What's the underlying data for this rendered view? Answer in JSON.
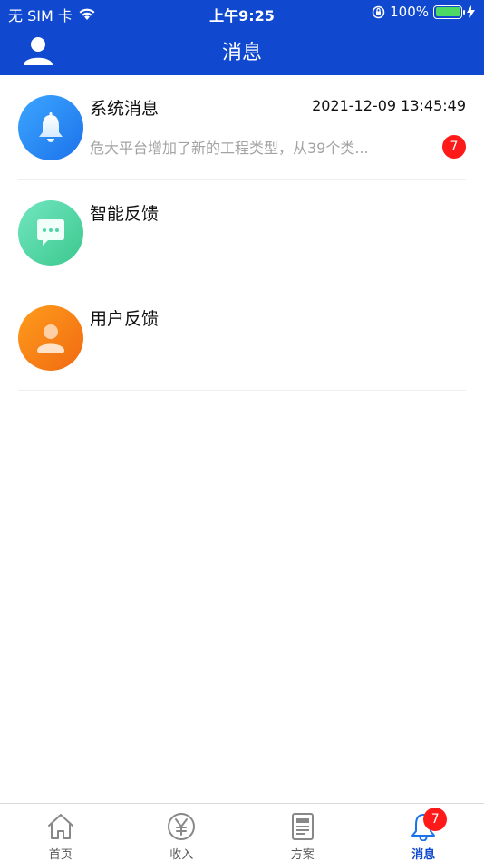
{
  "status_bar": {
    "carrier": "无 SIM 卡",
    "time": "上午9:25",
    "battery_percent": "100%",
    "battery_level": 1.0
  },
  "nav": {
    "title": "消息",
    "avatar_icon": "user-icon"
  },
  "messages": [
    {
      "title": "系统消息",
      "time": "2021-12-09 13:45:49",
      "preview": "危大平台增加了新的工程类型，从39个类...",
      "badge": "7",
      "icon": "bell-icon",
      "color": "#1c72ea"
    },
    {
      "title": "智能反馈",
      "icon": "chat-bubble-icon",
      "color": "#3cc88e"
    },
    {
      "title": "用户反馈",
      "icon": "user-icon",
      "color": "#f06a12"
    }
  ],
  "tabs": [
    {
      "label": "首页",
      "icon": "home-icon"
    },
    {
      "label": "收入",
      "icon": "yen-circle-icon"
    },
    {
      "label": "方案",
      "icon": "document-icon"
    },
    {
      "label": "消息",
      "icon": "bell-icon",
      "badge": "7",
      "active": true
    }
  ],
  "colors": {
    "brand": "#1049cf",
    "badge": "#ff1a1a"
  }
}
